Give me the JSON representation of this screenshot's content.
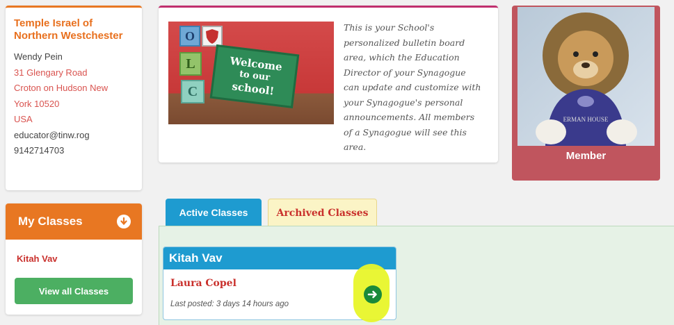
{
  "school": {
    "name": "Temple Israel of Northern Westchester",
    "contact_name": "Wendy Pein",
    "address_line1": "31 Glengary Road",
    "address_line2": "Croton on Hudson New",
    "address_line3": "York 10520",
    "country": "USA",
    "email": "educator@tinw.rog",
    "phone": "9142714703"
  },
  "my_classes": {
    "title": "My Classes",
    "icon": "chevron-down-circle-icon",
    "items": [
      {
        "label": "Kitah Vav"
      }
    ],
    "view_all_label": "View all Classes"
  },
  "bulletin": {
    "image_blocks": [
      "O",
      "L",
      "C"
    ],
    "image_sign": [
      "Welcome",
      "to our",
      "school!"
    ],
    "text": "This is your School's personalized bulletin board area, which the Education Director of your Synagogue can update and customize with your Synagogue's personal announcements. All members of a Synagogue will see this area."
  },
  "member": {
    "label": "Member",
    "shirt_text": "ERMAN HOUSE"
  },
  "tabs": [
    {
      "label": "Active Classes",
      "active": true
    },
    {
      "label": "Archived Classes",
      "active": false
    }
  ],
  "class_card": {
    "title": "Kitah Vav",
    "teacher": "Laura Copel",
    "last_posted": "Last posted: 3 days 14 hours ago",
    "go_icon": "arrow-right-circle-icon"
  },
  "colors": {
    "orange": "#e87722",
    "blue": "#1e9bd0",
    "green_button": "#4caf62",
    "member_bg": "#c0555e",
    "link_red": "#c9302c",
    "highlight": "#e8f52a"
  }
}
